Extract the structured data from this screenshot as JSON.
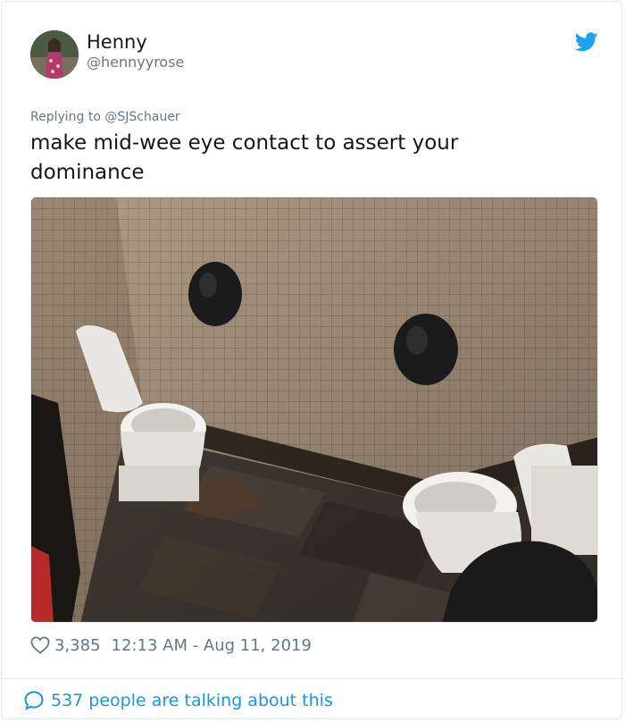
{
  "author": {
    "display_name": "Henny",
    "handle": "@hennyyrose",
    "avatar_icon": "user-avatar-photo"
  },
  "brand": {
    "icon": "twitter-bird-icon",
    "color": "#1da1f2"
  },
  "reply": {
    "prefix": "Replying to",
    "mention": "@SJSchauer"
  },
  "tweet": {
    "text": "make mid-wee eye contact to assert your dominance",
    "image_alt": "Restroom with two toilets facing each other"
  },
  "meta": {
    "likes": "3,385",
    "timestamp": "12:13 AM - Aug 11, 2019",
    "like_icon": "heart-icon"
  },
  "footer": {
    "talking_text": "537 people are talking about this",
    "icon": "speech-bubble-icon",
    "link_color": "#1b95e0"
  }
}
